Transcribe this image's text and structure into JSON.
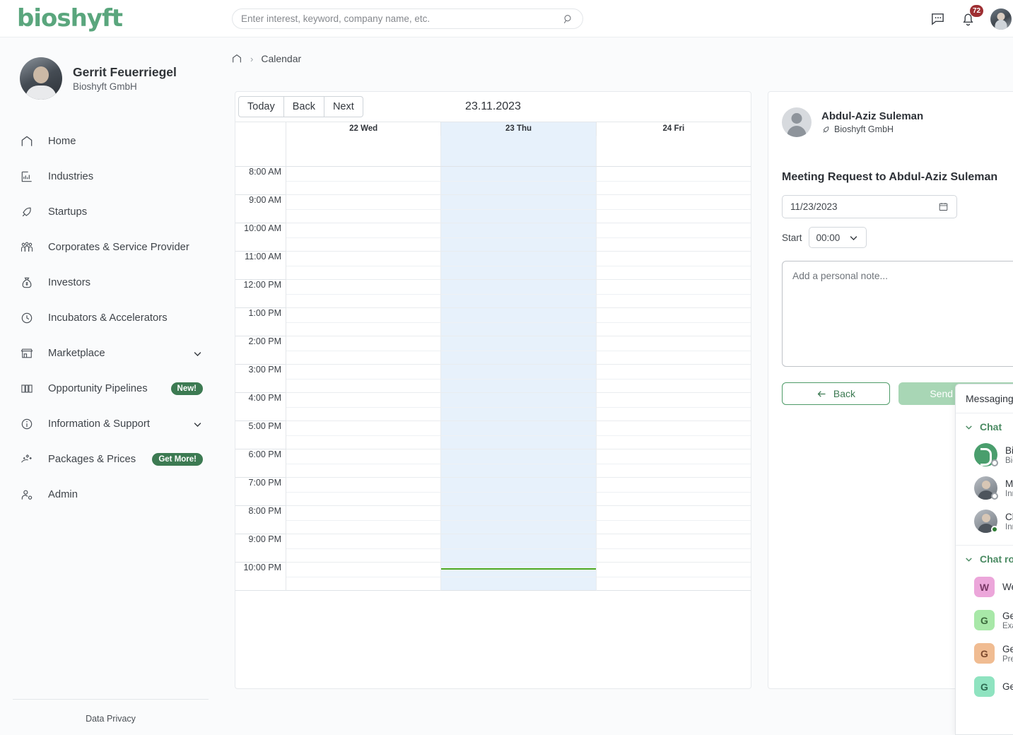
{
  "app": {
    "logo_text": "bioshyft"
  },
  "topbar": {
    "search_placeholder": "Enter interest, keyword, company name, etc.",
    "search_value": "",
    "notification_count": "72"
  },
  "sidebar": {
    "profile": {
      "name": "Gerrit Feuerriegel",
      "org": "Bioshyft GmbH"
    },
    "items": [
      {
        "label": "Home",
        "icon": "home-icon",
        "badge": "",
        "chevron": false
      },
      {
        "label": "Industries",
        "icon": "industries-icon",
        "badge": "",
        "chevron": false
      },
      {
        "label": "Startups",
        "icon": "rocket-icon",
        "badge": "",
        "chevron": false
      },
      {
        "label": "Corporates & Service Provider",
        "icon": "people-icon",
        "badge": "",
        "chevron": false
      },
      {
        "label": "Investors",
        "icon": "money-bag-icon",
        "badge": "",
        "chevron": false
      },
      {
        "label": "Incubators & Accelerators",
        "icon": "clock-icon",
        "badge": "",
        "chevron": false
      },
      {
        "label": "Marketplace",
        "icon": "store-icon",
        "badge": "",
        "chevron": true
      },
      {
        "label": "Opportunity Pipelines",
        "icon": "pipeline-icon",
        "badge": "New!",
        "chevron": false
      },
      {
        "label": "Information & Support",
        "icon": "info-icon",
        "badge": "",
        "chevron": true
      },
      {
        "label": "Packages & Prices",
        "icon": "package-icon",
        "badge": "Get More!",
        "chevron": false
      },
      {
        "label": "Admin",
        "icon": "admin-user-icon",
        "badge": "",
        "chevron": false
      }
    ],
    "footer_link": "Data Privacy"
  },
  "breadcrumb": {
    "home_icon": "home-icon",
    "separator": "›",
    "current": "Calendar"
  },
  "calendar": {
    "buttons": {
      "today": "Today",
      "back": "Back",
      "next": "Next"
    },
    "date_label": "23.11.2023",
    "days": [
      {
        "label": "22 Wed",
        "today": false
      },
      {
        "label": "23 Thu",
        "today": true
      },
      {
        "label": "24 Fri",
        "today": false
      }
    ],
    "hours": [
      "8:00 AM",
      "9:00 AM",
      "10:00 AM",
      "11:00 AM",
      "12:00 PM",
      "1:00 PM",
      "2:00 PM",
      "3:00 PM",
      "4:00 PM",
      "5:00 PM",
      "6:00 PM",
      "7:00 PM",
      "8:00 PM",
      "9:00 PM",
      "10:00 PM"
    ],
    "now_indicator": {
      "color": "#4faa21",
      "day_index": 1,
      "hour_index": 14,
      "offset_pct": 20
    }
  },
  "meeting_panel": {
    "person": {
      "name": "Abdul-Aziz Suleman",
      "org": "Bioshyft GmbH",
      "org_icon": "rocket-icon"
    },
    "close_icon": "close-icon",
    "title": "Meeting Request to Abdul-Aziz Suleman",
    "date_value": "11/23/2023",
    "date_icon": "calendar-icon",
    "start_label": "Start",
    "start_value": "00:00",
    "note_placeholder": "Add a personal note...",
    "note_value": "",
    "back_button": "Back",
    "send_button": "Send request",
    "send_disabled": true
  },
  "messaging": {
    "title": "Messaging",
    "chat_section": {
      "label": "Chat",
      "expanded": true
    },
    "chats": [
      {
        "name": "Bio",
        "sub": "Bios",
        "avatar": "logo",
        "status": "off"
      },
      {
        "name": "Ma",
        "sub": "Inn",
        "avatar": "photo",
        "status": "off"
      },
      {
        "name": "Chr",
        "sub": "Inn",
        "avatar": "photo",
        "status": "on"
      }
    ],
    "rooms_section": {
      "label": "Chat roo",
      "expanded": true
    },
    "rooms": [
      {
        "initial": "W",
        "name": "We",
        "sub": "",
        "color": "#eca6da"
      },
      {
        "initial": "G",
        "name": "Ge",
        "sub": "Exa",
        "color": "#a8e8a8"
      },
      {
        "initial": "G",
        "name": "Ge",
        "sub": "Pre",
        "color": "#f0bc92"
      },
      {
        "initial": "G",
        "name": "Ge",
        "sub": "",
        "color": "#8fe3c0"
      }
    ]
  },
  "colors": {
    "brand_green": "#5aa67d",
    "accent_green": "#3c7a52",
    "today_blue": "#e7f1fb",
    "badge_red": "#9e2f33"
  }
}
